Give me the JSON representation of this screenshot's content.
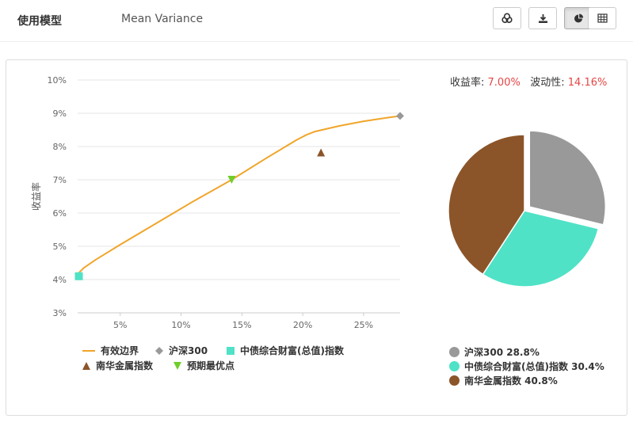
{
  "header": {
    "model_label": "使用模型",
    "model_value": "Mean Variance",
    "toolbar": [
      {
        "icon": "coins-icon",
        "active": false
      },
      {
        "icon": "download-icon",
        "active": false
      },
      {
        "icon": "pie-chart-icon",
        "active": true
      },
      {
        "icon": "table-icon",
        "active": false
      }
    ]
  },
  "stats": {
    "return_label": "收益率:",
    "return_value": "7.00%",
    "vol_label": "波动性:",
    "vol_value": "14.16%"
  },
  "colors": {
    "frontier": "#f0a52a",
    "hs300": "#999999",
    "bond": "#4fe2c6",
    "metal": "#8b5529",
    "optimal": "#6fce29",
    "highlight": "#e64545"
  },
  "chart_data": [
    {
      "type": "line",
      "ylabel": "收益率",
      "xlabel": "",
      "xlim": [
        1.5,
        28
      ],
      "ylim": [
        3,
        10
      ],
      "x_ticks": [
        "5%",
        "10%",
        "15%",
        "20%",
        "25%"
      ],
      "y_ticks": [
        "3%",
        "4%",
        "5%",
        "6%",
        "7%",
        "8%",
        "9%",
        "10%"
      ],
      "grid": true,
      "legend_position": "bottom",
      "series": [
        {
          "name": "有效边界",
          "kind": "line",
          "x": [
            1.6,
            2.0,
            3.0,
            5.0,
            8.0,
            11.0,
            14.16,
            17.0,
            19.5,
            20.3,
            21.0,
            23.0,
            25.0,
            27.0,
            28.0
          ],
          "y": [
            4.2,
            4.35,
            4.6,
            5.05,
            5.7,
            6.35,
            7.0,
            7.65,
            8.2,
            8.35,
            8.45,
            8.62,
            8.76,
            8.87,
            8.92
          ]
        },
        {
          "name": "沪深300",
          "kind": "point",
          "marker": "diamond",
          "x": [
            28.0
          ],
          "y": [
            8.92
          ]
        },
        {
          "name": "中债综合财富(总值)指数",
          "kind": "point",
          "marker": "square",
          "x": [
            1.6
          ],
          "y": [
            4.1
          ]
        },
        {
          "name": "南华金属指数",
          "kind": "point",
          "marker": "triangle-up",
          "x": [
            21.5
          ],
          "y": [
            7.82
          ]
        },
        {
          "name": "预期最优点",
          "kind": "point",
          "marker": "triangle-down",
          "x": [
            14.16
          ],
          "y": [
            7.0
          ]
        }
      ]
    },
    {
      "type": "pie",
      "slices": [
        {
          "name": "沪深300",
          "value": 28.8,
          "label": "沪深300 28.8%"
        },
        {
          "name": "中债综合财富(总值)指数",
          "value": 30.4,
          "label": "中债综合财富(总值)指数 30.4%"
        },
        {
          "name": "南华金属指数",
          "value": 40.8,
          "label": "南华金属指数 40.8%"
        }
      ]
    }
  ]
}
